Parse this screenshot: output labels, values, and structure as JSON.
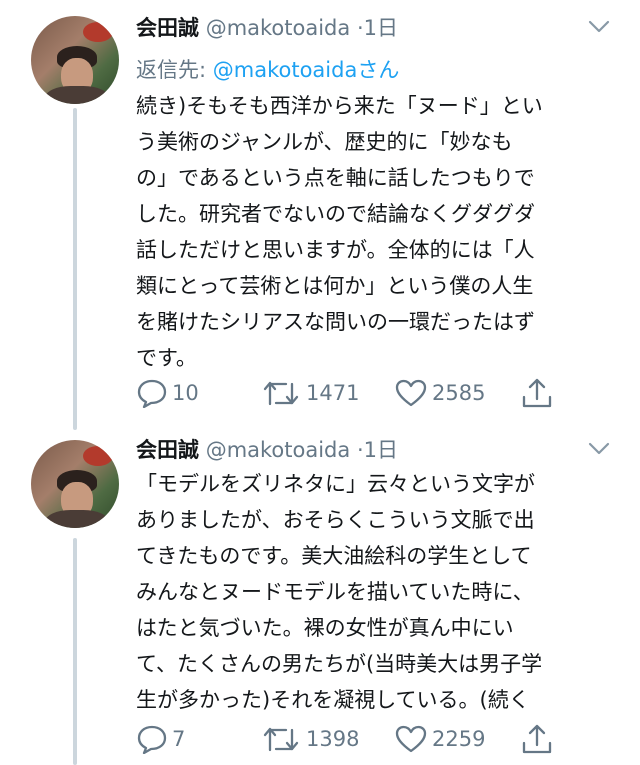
{
  "tweets": [
    {
      "name": "会田誠",
      "handle": "@makotoaida",
      "separator": "·",
      "time": "1日",
      "reply_prefix": "返信先: ",
      "reply_mention": "@makotoaida",
      "reply_suffix": "さん",
      "lines": [
        "続き)そもそも西洋から来た「ヌード」とい",
        "う美術のジャンルが、歴史的に「妙なも",
        "の」であるという点を軸に話したつもりで",
        "した。研究者でないので結論なくグダグダ",
        "話しただけと思いますが。全体的には「人",
        "類にとって芸術とは何か」という僕の人生",
        "を賭けたシリアスな問いの一環だったはず",
        "です。"
      ],
      "reply_count": "10",
      "retweet_count": "1471",
      "like_count": "2585"
    },
    {
      "name": "会田誠",
      "handle": "@makotoaida",
      "separator": "·",
      "time": "1日",
      "lines": [
        "「モデルをズリネタに」云々という文字が",
        "ありましたが、おそらくこういう文脈で出",
        "てきたものです。美大油絵科の学生として",
        "みんなとヌードモデルを描いていた時に、",
        "はたと気づいた。裸の女性が真ん中にい",
        "て、たくさんの男たちが(当時美大は男子学",
        "生が多かった)それを凝視している。(続く"
      ],
      "reply_count": "7",
      "retweet_count": "1398",
      "like_count": "2259"
    }
  ],
  "colors": {
    "text": "#14171a",
    "muted": "#657786",
    "link": "#1da1f2",
    "thread_line": "#ccd6dd"
  },
  "icons": [
    "reply-icon",
    "retweet-icon",
    "like-icon",
    "share-icon",
    "chevron-down-icon"
  ]
}
